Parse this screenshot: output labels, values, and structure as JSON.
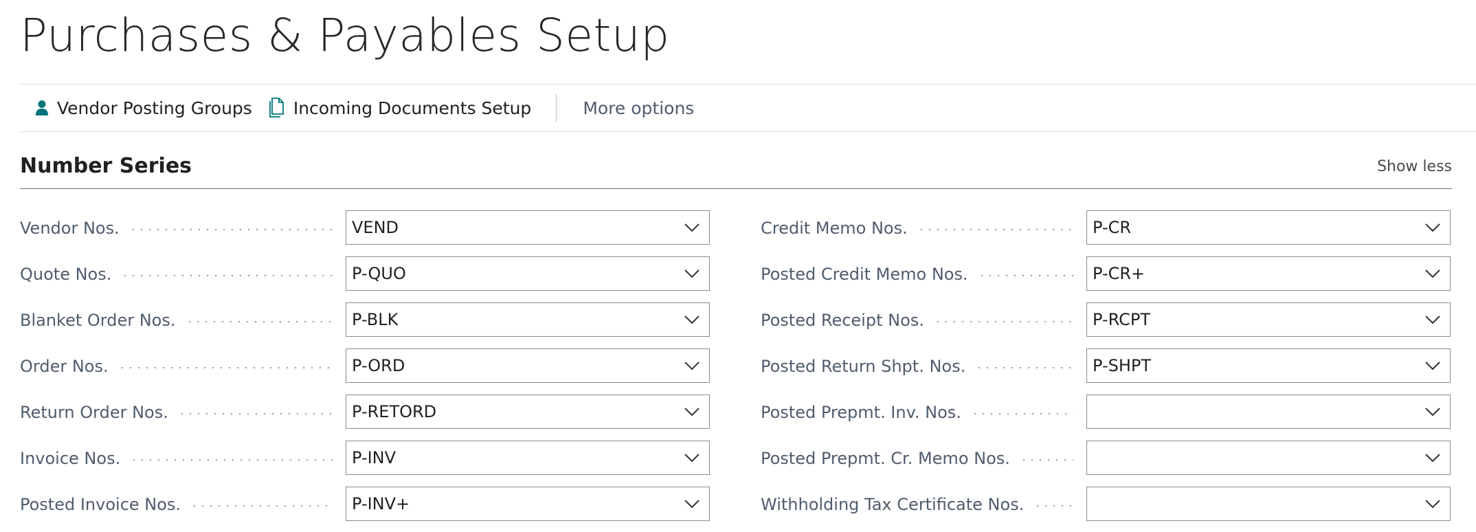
{
  "page": {
    "title": "Purchases & Payables Setup"
  },
  "actions": {
    "vendor_posting_groups": "Vendor Posting Groups",
    "incoming_documents_setup": "Incoming Documents Setup",
    "more_options": "More options"
  },
  "section": {
    "title": "Number Series",
    "toggle_label": "Show less"
  },
  "fields": {
    "left": [
      {
        "label": "Vendor Nos.",
        "value": "VEND"
      },
      {
        "label": "Quote Nos.",
        "value": "P-QUO"
      },
      {
        "label": "Blanket Order Nos.",
        "value": "P-BLK"
      },
      {
        "label": "Order Nos.",
        "value": "P-ORD"
      },
      {
        "label": "Return Order Nos.",
        "value": "P-RETORD"
      },
      {
        "label": "Invoice Nos.",
        "value": "P-INV"
      },
      {
        "label": "Posted Invoice Nos.",
        "value": "P-INV+"
      }
    ],
    "right": [
      {
        "label": "Credit Memo Nos.",
        "value": "P-CR"
      },
      {
        "label": "Posted Credit Memo Nos.",
        "value": "P-CR+"
      },
      {
        "label": "Posted Receipt Nos.",
        "value": "P-RCPT"
      },
      {
        "label": "Posted Return Shpt. Nos.",
        "value": "P-SHPT"
      },
      {
        "label": "Posted Prepmt. Inv. Nos.",
        "value": ""
      },
      {
        "label": "Posted Prepmt. Cr. Memo Nos.",
        "value": ""
      },
      {
        "label": "Withholding Tax Certificate Nos.",
        "value": ""
      }
    ]
  },
  "icons": {
    "vendor_posting_groups": "person-icon",
    "incoming_documents_setup": "document-copy-icon",
    "dropdown": "chevron-down-icon"
  },
  "colors": {
    "accent_icon": "#00757a",
    "label_text": "#505c6d",
    "section_rule": "#6e6e6e"
  }
}
